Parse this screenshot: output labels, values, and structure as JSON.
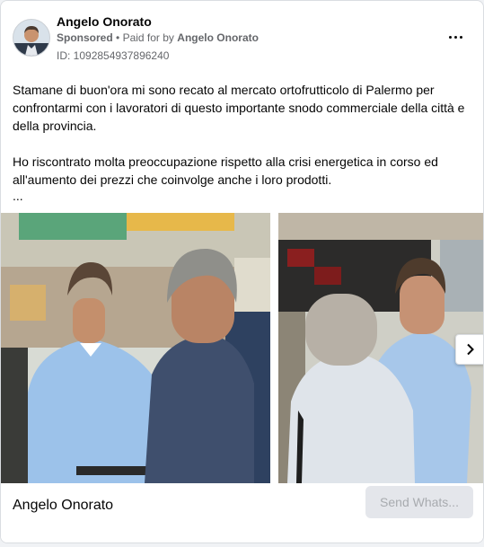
{
  "post": {
    "author": "Angelo Onorato",
    "sponsored_label": "Sponsored",
    "separator": "•",
    "paid_for_by": "Paid for by",
    "payer": "Angelo Onorato",
    "ad_id": "ID: 1092854937896240",
    "paragraphs": [
      "Stamane di buon'ora mi sono recato al mercato ortofrutticolo di Palermo per confrontarmi con i lavoratori di questo importante snodo commerciale della città e della provincia.",
      "Ho riscontrato molta preoccupazione rispetto alla crisi energetica in corso ed all'aumento dei prezzi che coinvolge anche i loro prodotti."
    ],
    "ellipsis": "..."
  },
  "icons": {
    "more": "more-horizontal-icon",
    "next": "chevron-right-icon"
  },
  "footer": {
    "name": "Angelo Onorato",
    "cta": "Send Whats..."
  },
  "colors": {
    "secondary_text": "#65676b",
    "disabled_button_bg": "#e4e6eb",
    "disabled_button_text": "#a8abaf"
  }
}
